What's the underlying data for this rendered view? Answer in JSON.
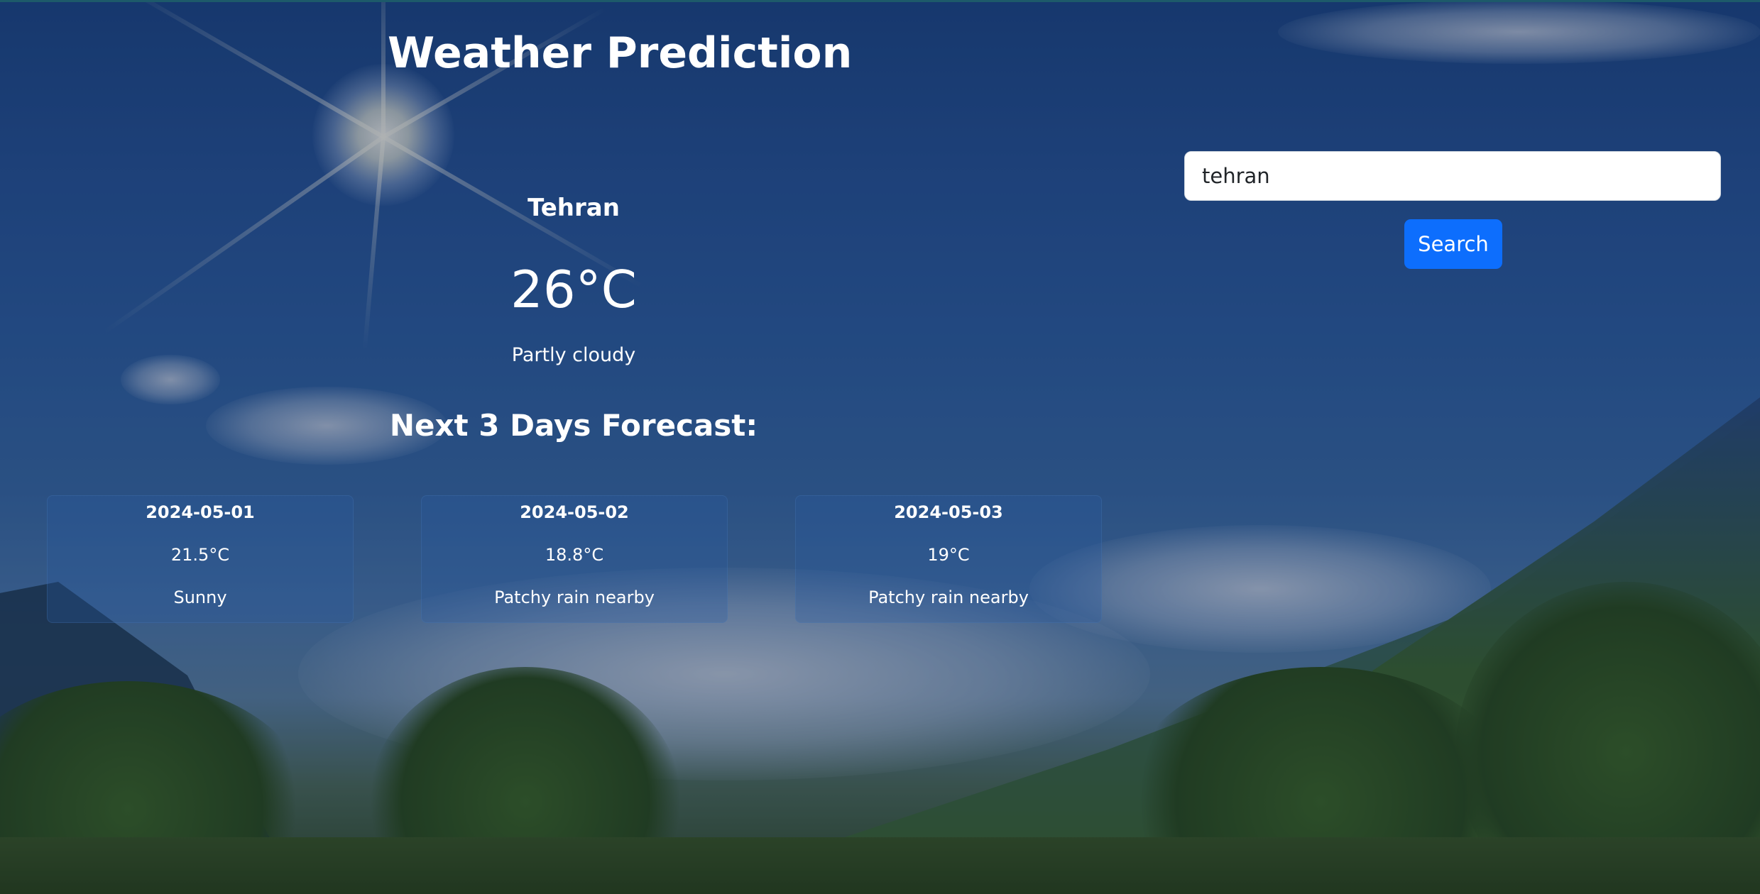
{
  "app": {
    "title": "Weather Prediction"
  },
  "search": {
    "value": "tehran",
    "button_label": "Search"
  },
  "current": {
    "city": "Tehran",
    "temperature": "26°C",
    "condition": "Partly cloudy"
  },
  "forecast": {
    "heading": "Next 3 Days Forecast:",
    "days": [
      {
        "date": "2024-05-01",
        "temperature": "21.5°C",
        "condition": "Sunny"
      },
      {
        "date": "2024-05-02",
        "temperature": "18.8°C",
        "condition": "Patchy rain nearby"
      },
      {
        "date": "2024-05-03",
        "temperature": "19°C",
        "condition": "Patchy rain nearby"
      }
    ]
  },
  "colors": {
    "accent": "#0d6efd",
    "text": "#ffffff"
  }
}
